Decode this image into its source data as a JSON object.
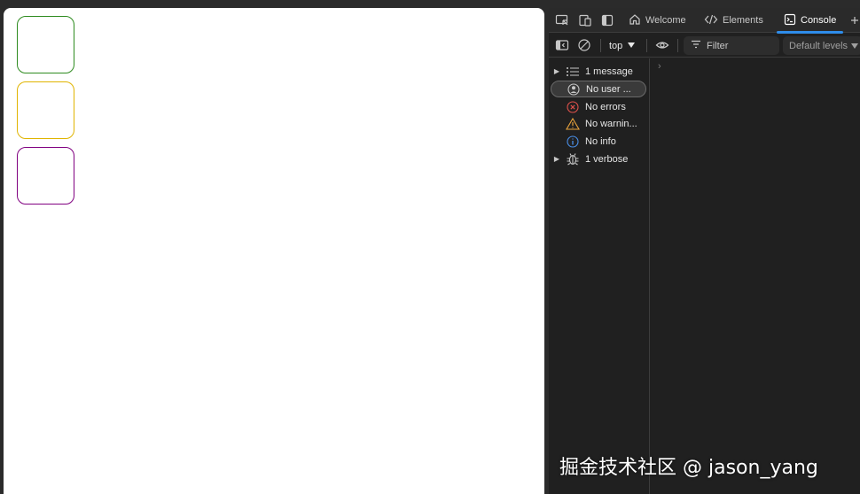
{
  "viewport": {
    "boxes": [
      {
        "name": "green",
        "border_color": "#2e8b1f"
      },
      {
        "name": "yellow",
        "border_color": "#e0b400"
      },
      {
        "name": "purple",
        "border_color": "#800080"
      }
    ]
  },
  "devtools": {
    "tabs": [
      {
        "label": "Welcome",
        "icon": "home-icon",
        "active": false
      },
      {
        "label": "Elements",
        "icon": "code-brackets-icon",
        "active": false
      },
      {
        "label": "Console",
        "icon": "console-icon",
        "active": true
      }
    ],
    "toolbar": {
      "context": "top",
      "filter_placeholder": "Filter",
      "levels": "Default levels"
    },
    "sidebar": [
      {
        "label": "1 message",
        "icon": "list-icon",
        "expandable": true,
        "selected": false
      },
      {
        "label": "No user ...",
        "icon": "user-icon",
        "expandable": false,
        "selected": true
      },
      {
        "label": "No errors",
        "icon": "error-icon",
        "expandable": false,
        "selected": false
      },
      {
        "label": "No warnin...",
        "icon": "warning-icon",
        "expandable": false,
        "selected": false
      },
      {
        "label": "No info",
        "icon": "info-icon",
        "expandable": false,
        "selected": false
      },
      {
        "label": "1 verbose",
        "icon": "bug-icon",
        "expandable": true,
        "selected": false
      }
    ],
    "prompt": "›",
    "colors": {
      "accent": "#2f8dea",
      "error": "#e0514b",
      "warning": "#e8a33c",
      "info": "#4a8fe7"
    }
  },
  "watermark": "掘金技术社区 @ jason_yang"
}
